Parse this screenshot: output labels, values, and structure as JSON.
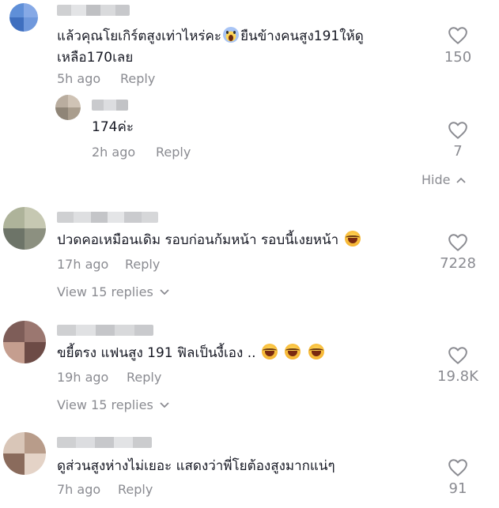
{
  "comments": [
    {
      "text": "แล้วคุณโยเกิร์ตสูงเท่าไหร่คะ",
      "text_after_emoji": "ยืนข้างคนสูง191ให้ดู",
      "text_line2": "เหลือ170เลย",
      "time": "5h ago",
      "reply_label": "Reply",
      "likes": "150",
      "replies": [
        {
          "text": "174ค่ะ",
          "time": "2h ago",
          "reply_label": "Reply",
          "likes": "7"
        }
      ],
      "hide_label": "Hide"
    },
    {
      "text": "ปวดคอเหมือนเดิม รอบก่อนก้มหน้า รอบนี้เงยหน้า",
      "time": "17h ago",
      "reply_label": "Reply",
      "likes": "7228",
      "view_replies": "View 15 replies"
    },
    {
      "text": "ขยี้ตรง แฟนสูง 191 ฟิลเป็นงี้เอง ..",
      "time": "19h ago",
      "reply_label": "Reply",
      "likes": "19.8K",
      "view_replies": "View 15 replies"
    },
    {
      "text": "ดูส่วนสูงห่างไม่เยอะ แสดงว่าพี่โยต้องสูงมากแน่ๆ",
      "time": "7h ago",
      "reply_label": "Reply",
      "likes": "91"
    }
  ],
  "colors": {
    "text": "#161823",
    "secondary": "#8a8b91"
  },
  "icons": {
    "like": "heart-outline-icon",
    "emoji_laugh": "face-with-tears-of-joy",
    "emoji_scream": "face-screaming-in-fear",
    "chevron": "chevron-icon"
  }
}
